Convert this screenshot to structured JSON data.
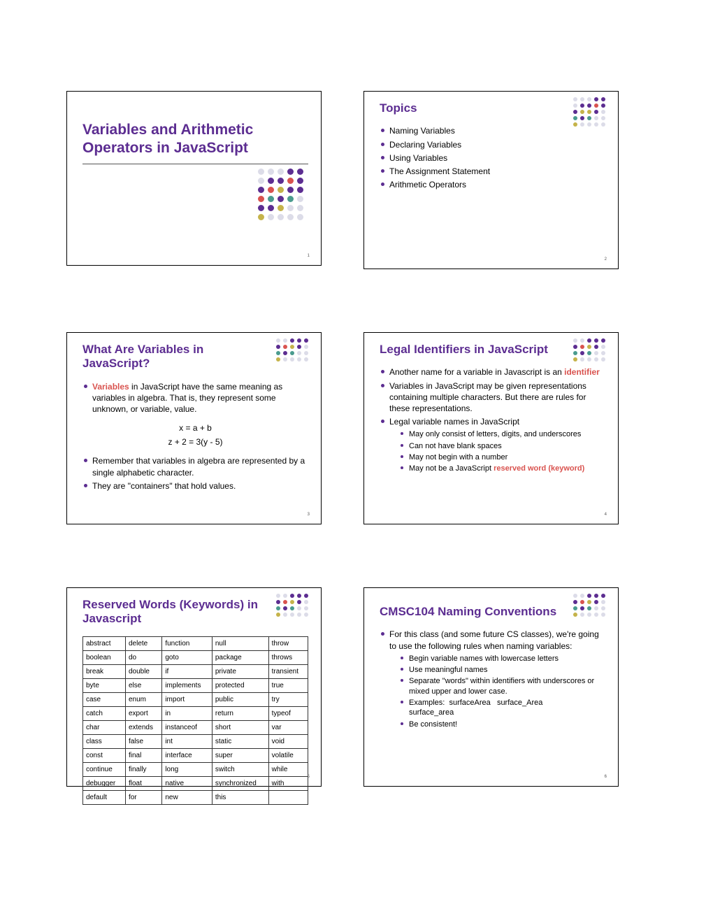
{
  "s1": {
    "title": "Variables and Arithmetic Operators in JavaScript",
    "num": "1"
  },
  "s2": {
    "title": "Topics",
    "num": "2",
    "items": [
      "Naming Variables",
      "Declaring Variables",
      "Using Variables",
      "The Assignment Statement",
      "Arithmetic Operators"
    ]
  },
  "s3": {
    "title": "What Are Variables in JavaScript?",
    "num": "3",
    "p1a": "Variables",
    "p1b": " in JavaScript have the same meaning as variables in algebra.  That is, they represent some unknown, or variable, value.",
    "eq1": "x = a + b",
    "eq2": "z + 2 = 3(y - 5)",
    "p2": "Remember that variables in algebra are represented by a single alphabetic character.",
    "p3": "They are \"containers\" that hold values."
  },
  "s4": {
    "title": "Legal Identifiers in JavaScript",
    "num": "4",
    "p1a": "Another name for a variable in Javascript is an ",
    "p1b": "identifier",
    "p2": "Variables in JavaScript may be given representations containing multiple characters.  But there are rules for these representations.",
    "p3": "Legal variable names in JavaScript",
    "sub": [
      "May only consist of letters, digits, and underscores",
      "Can not have blank spaces",
      "May not begin with a number"
    ],
    "p4a": "May not be a JavaScript ",
    "p4b": "reserved word (keyword)"
  },
  "s5": {
    "title": "Reserved Words (Keywords) in Javascript",
    "num": "5",
    "rows": [
      [
        "abstract",
        "delete",
        "function",
        "null",
        "throw"
      ],
      [
        "boolean",
        "do",
        "goto",
        "package",
        "throws"
      ],
      [
        "break",
        "double",
        "if",
        "private",
        "transient"
      ],
      [
        "byte",
        "else",
        "implements",
        "protected",
        "true"
      ],
      [
        "case",
        "enum",
        "import",
        "public",
        "try"
      ],
      [
        "catch",
        "export",
        "in",
        "return",
        "typeof"
      ],
      [
        "char",
        "extends",
        "instanceof",
        "short",
        "var"
      ],
      [
        "class",
        "false",
        "int",
        "static",
        "void"
      ],
      [
        "const",
        "final",
        "interface",
        "super",
        "volatile"
      ],
      [
        "continue",
        "finally",
        "long",
        "switch",
        "while"
      ],
      [
        "debugger",
        "float",
        "native",
        "synchronized",
        "with"
      ],
      [
        "default",
        "for",
        "new",
        "this",
        ""
      ]
    ]
  },
  "s6": {
    "title": "CMSC104 Naming Conventions",
    "num": "6",
    "p1": "For this class (and some future CS classes), we're going to use the following rules when naming variables:",
    "sub": [
      "Begin variable names with lowercase letters",
      "Use meaningful names",
      "Separate \"words\" within identifiers with underscores or mixed upper and lower case.",
      "Examples:  surfaceArea   surface_Area            surface_area",
      "Be consistent!"
    ]
  }
}
